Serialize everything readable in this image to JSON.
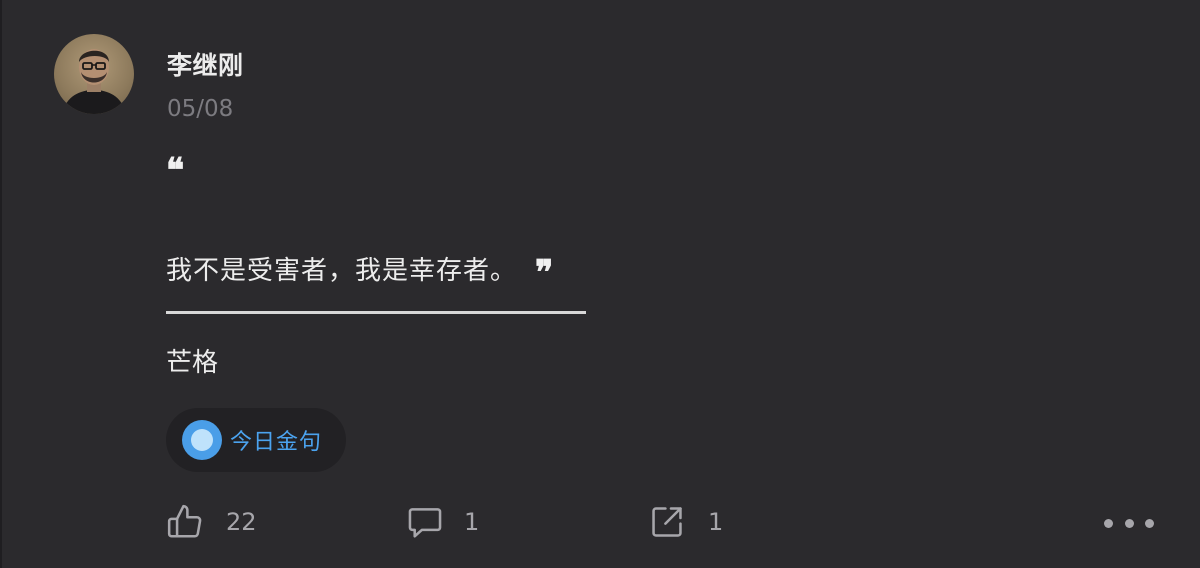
{
  "post": {
    "author": "李继刚",
    "date": "05/08",
    "open_quote": "❝",
    "quote": "我不是受害者，我是幸存者。",
    "close_quote": "❞",
    "source": "芒格",
    "tag": "今日金句"
  },
  "actions": {
    "likes": "22",
    "comments": "1",
    "shares": "1"
  },
  "colors": {
    "background": "#2b2a2d",
    "accent": "#4ba3ef",
    "muted": "#7c7b80"
  },
  "icons": {
    "like": "thumbs-up-icon",
    "comment": "comment-icon",
    "share": "share-icon",
    "more": "more-horizontal-icon"
  }
}
